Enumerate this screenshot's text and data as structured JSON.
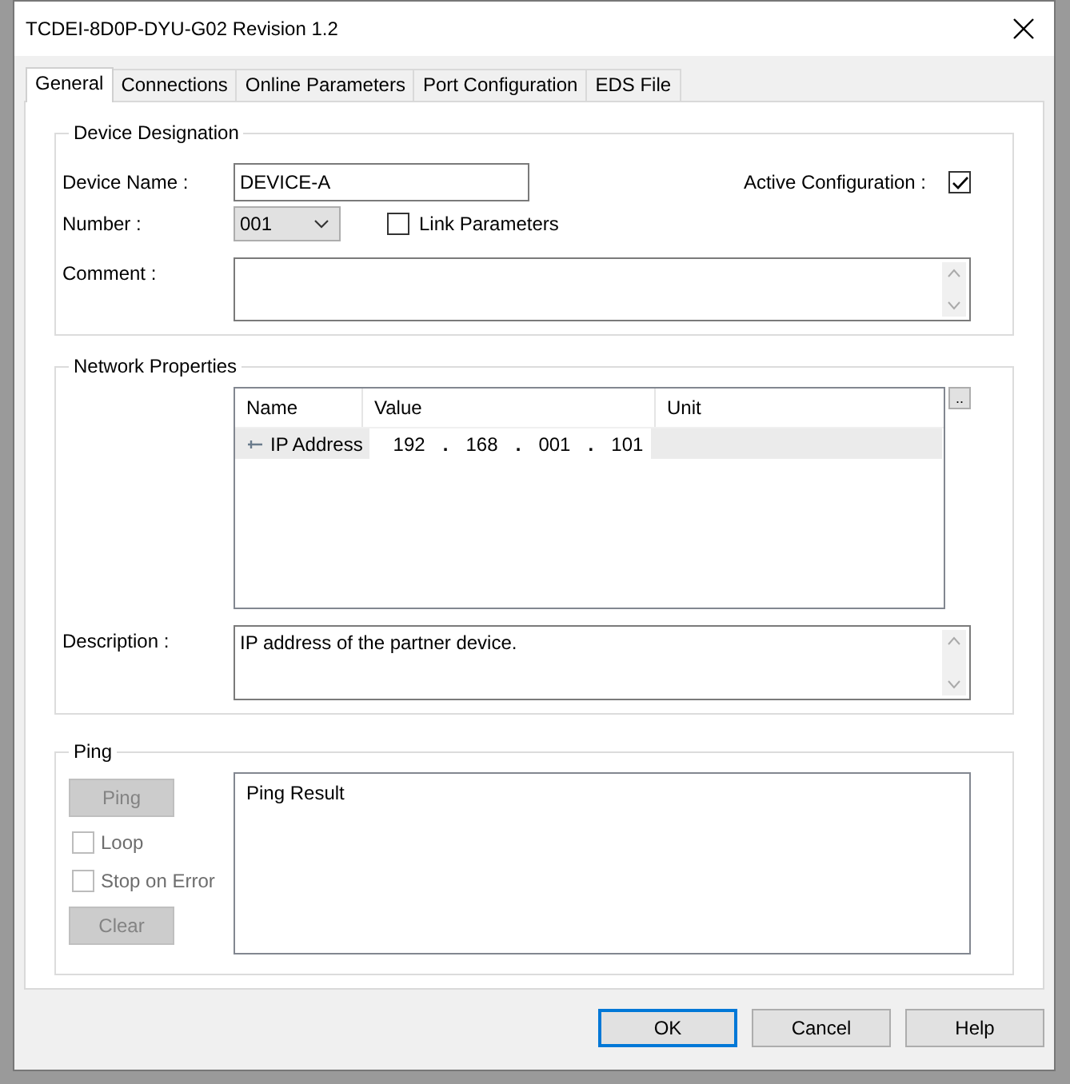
{
  "window": {
    "title": "TCDEI-8D0P-DYU-G02 Revision 1.2"
  },
  "tabs": [
    {
      "label": "General",
      "selected": true
    },
    {
      "label": "Connections",
      "selected": false
    },
    {
      "label": "Online Parameters",
      "selected": false
    },
    {
      "label": "Port Configuration",
      "selected": false
    },
    {
      "label": "EDS File",
      "selected": false
    }
  ],
  "device_designation": {
    "title": "Device Designation",
    "device_name": {
      "label": "Device Name :",
      "value": "DEVICE-A"
    },
    "active_configuration": {
      "label": "Active Configuration :",
      "checked": true
    },
    "number": {
      "label": "Number :",
      "value": "001"
    },
    "link_parameters": {
      "label": "Link Parameters",
      "checked": false
    },
    "comment": {
      "label": "Comment :"
    }
  },
  "network_properties": {
    "title": "Network Properties",
    "columns": [
      "Name",
      "Value",
      "Unit"
    ],
    "rows": [
      {
        "name": "IP Address",
        "octets": [
          "192",
          "168",
          "001",
          "101"
        ],
        "separator": ".",
        "selected": true
      }
    ],
    "more_button": "..",
    "description": {
      "label": "Description :",
      "value": "IP address of the partner device."
    }
  },
  "ping": {
    "title": "Ping",
    "ping_button": {
      "label": "Ping",
      "disabled": true
    },
    "options": [
      {
        "label": "Loop",
        "checked": false,
        "disabled": true
      },
      {
        "label": "Stop on Error",
        "checked": false,
        "disabled": true
      }
    ],
    "clear_button": {
      "label": "Clear",
      "disabled": true
    },
    "result_header": "Ping Result"
  },
  "buttons": [
    {
      "label": "OK",
      "default": true
    },
    {
      "label": "Cancel",
      "default": false
    },
    {
      "label": "Help",
      "default": false
    }
  ]
}
